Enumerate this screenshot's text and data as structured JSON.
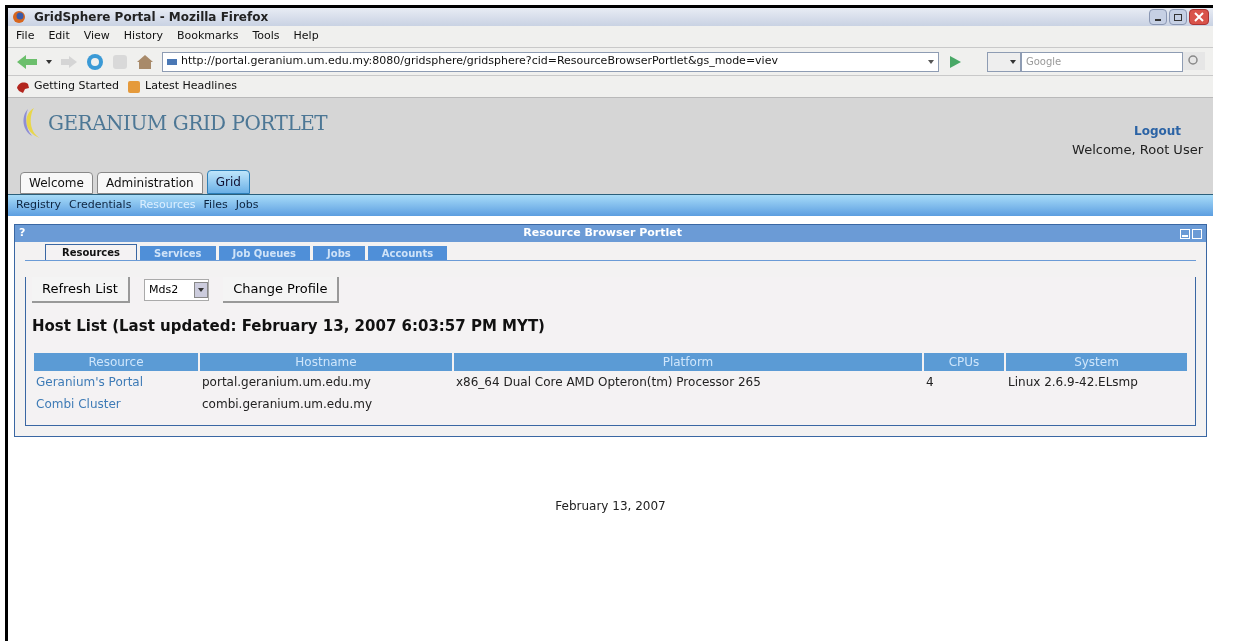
{
  "window": {
    "title": "GridSphere Portal - Mozilla Firefox"
  },
  "menu": [
    "File",
    "Edit",
    "View",
    "History",
    "Bookmarks",
    "Tools",
    "Help"
  ],
  "address_bar": {
    "value": "http://portal.geranium.um.edu.my:8080/gridsphere/gridsphere?cid=ResourceBrowserPortlet&gs_mode=viev"
  },
  "search": {
    "placeholder": "Google"
  },
  "bookmarks": [
    "Getting Started",
    "Latest Headlines"
  ],
  "portal": {
    "logo": "GERANIUM GRID PORTLET",
    "logout": "Logout",
    "welcome": "Welcome, Root User",
    "tabs": [
      {
        "label": "Welcome",
        "selected": false
      },
      {
        "label": "Administration",
        "selected": false
      },
      {
        "label": "Grid",
        "selected": true
      }
    ],
    "subnav": [
      {
        "label": "Registry",
        "selected": false
      },
      {
        "label": "Credentials",
        "selected": false
      },
      {
        "label": "Resources",
        "selected": true
      },
      {
        "label": "Files",
        "selected": false
      },
      {
        "label": "Jobs",
        "selected": false
      }
    ]
  },
  "portlet": {
    "help": "?",
    "title": "Resource Browser Portlet",
    "tabs": [
      {
        "label": "Resources",
        "selected": true
      },
      {
        "label": "Services",
        "selected": false
      },
      {
        "label": "Job Queues",
        "selected": false
      },
      {
        "label": "Jobs",
        "selected": false
      },
      {
        "label": "Accounts",
        "selected": false
      }
    ],
    "buttons": [
      "Refresh List",
      "Change Profile"
    ],
    "profile": "Mds2",
    "heading": "Host List (Last updated: February 13, 2007 6:03:57 PM MYT)",
    "table": {
      "columns": [
        "Resource",
        "Hostname",
        "Platform",
        "CPUs",
        "System"
      ],
      "rows": [
        {
          "cells": [
            "Geranium's Portal",
            "portal.geranium.um.edu.my",
            "x86_64 Dual Core AMD Opteron(tm) Processor 265",
            "4",
            "Linux 2.6.9-42.ELsmp"
          ]
        },
        {
          "cells": [
            "Combi Cluster",
            "combi.geranium.um.edu.my"
          ]
        }
      ]
    }
  },
  "footer": "February 13, 2007"
}
